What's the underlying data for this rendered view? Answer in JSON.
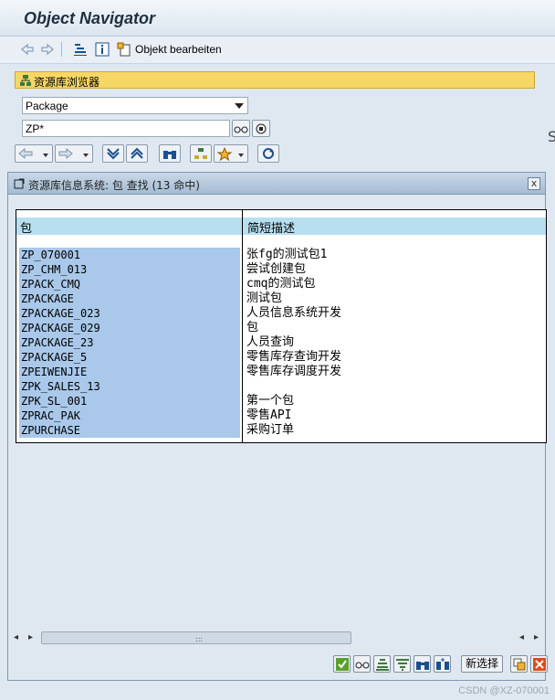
{
  "app": {
    "title": "Object Navigator"
  },
  "toolbar": {
    "edit_object_label": "Objekt bearbeiten"
  },
  "navigator": {
    "repo_browser_label": "资源库浏览器",
    "object_type": "Package",
    "search_value": "ZP*"
  },
  "dialog": {
    "title": "资源库信息系统: 包 查找 (13 命中)",
    "close_label": "x",
    "columns": [
      "包",
      "简短描述"
    ],
    "rows": [
      {
        "pkg": "ZP_070001",
        "desc": "张fg的测试包1"
      },
      {
        "pkg": "ZP_CHM_013",
        "desc": "尝试创建包"
      },
      {
        "pkg": "ZPACK_CMQ",
        "desc": "cmq的测试包"
      },
      {
        "pkg": "ZPACKAGE",
        "desc": "测试包"
      },
      {
        "pkg": "ZPACKAGE_023",
        "desc": "人员信息系统开发"
      },
      {
        "pkg": "ZPACKAGE_029",
        "desc": "包"
      },
      {
        "pkg": "ZPACKAGE_23",
        "desc": "人员查询"
      },
      {
        "pkg": "ZPACKAGE_5",
        "desc": "零售库存查询开发"
      },
      {
        "pkg": "ZPEIWENJIE",
        "desc": "零售库存调度开发"
      },
      {
        "pkg": "ZPK_SALES_13",
        "desc": ""
      },
      {
        "pkg": "ZPK_SL_001",
        "desc": "第一个包"
      },
      {
        "pkg": "ZPRAC_PAK",
        "desc": "零售API"
      },
      {
        "pkg": "ZPURCHASE",
        "desc": "采购订单"
      }
    ],
    "new_selection_label": "新选择"
  },
  "watermark": "CSDN @XZ-070001",
  "colors": {
    "header_yellow": "#f6d766",
    "key_cell_blue": "#a9c8ea",
    "column_header": "#b7dff0"
  }
}
